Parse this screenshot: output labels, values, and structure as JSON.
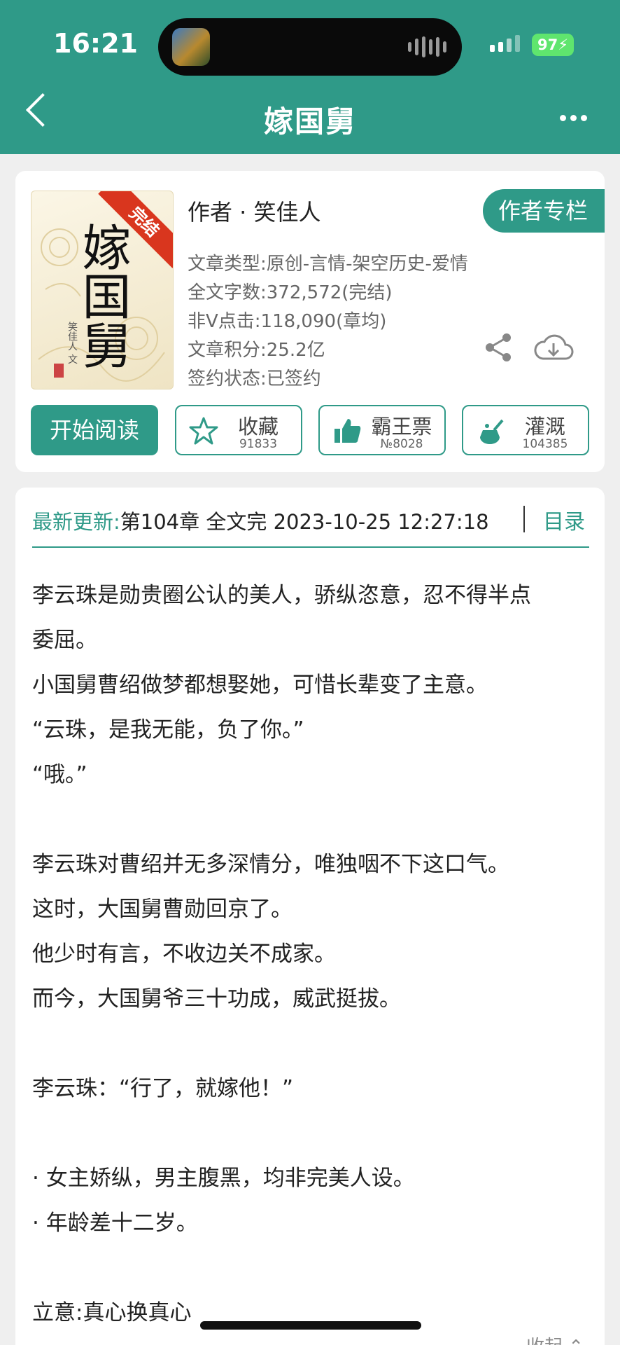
{
  "status_bar": {
    "time": "16:21",
    "battery": "97"
  },
  "header": {
    "title": "嫁国舅"
  },
  "book": {
    "cover": {
      "ribbon": "完结",
      "title": "嫁国舅",
      "author_mark": "笑佳人 文"
    },
    "author_line": "作者 · 笑佳人",
    "author_column_button": "作者专栏",
    "info": [
      "文章类型:原创-言情-架空历史-爱情",
      "全文字数:372,572(完结)",
      "非V点击:118,090(章均)",
      "文章积分:25.2亿",
      "签约状态:已签约"
    ]
  },
  "actions": {
    "read": "开始阅读",
    "buttons": [
      {
        "label": "收藏",
        "count": "91833"
      },
      {
        "label": "霸王票",
        "count": "№8028"
      },
      {
        "label": "灌溉",
        "count": "104385"
      }
    ]
  },
  "update": {
    "label": "最新更新:",
    "value": "第104章 全文完 2023-10-25 12:27:18",
    "toc": "目录"
  },
  "synopsis": [
    "李云珠是勋贵圈公认的美人，骄纵恣意，忍不得半点",
    "委屈。",
    "小国舅曹绍做梦都想娶她，可惜长辈变了主意。",
    "“云珠，是我无能，负了你。”",
    "“哦。”",
    "",
    "李云珠对曹绍并无多深情分，唯独咽不下这口气。",
    "这时，大国舅曹勋回京了。",
    "他少时有言，不收边关不成家。",
    "而今，大国舅爷三十功成，威武挺拔。",
    "",
    "李云珠：“行了，就嫁他！”",
    "",
    "· 女主娇纵，男主腹黑，均非完美人设。",
    "· 年龄差十二岁。",
    "",
    "立意:真心换真心"
  ],
  "collapse_label": "收起",
  "colors": {
    "accent": "#2f9a88",
    "ribbon": "#d9361e",
    "battery": "#5fe56e"
  }
}
